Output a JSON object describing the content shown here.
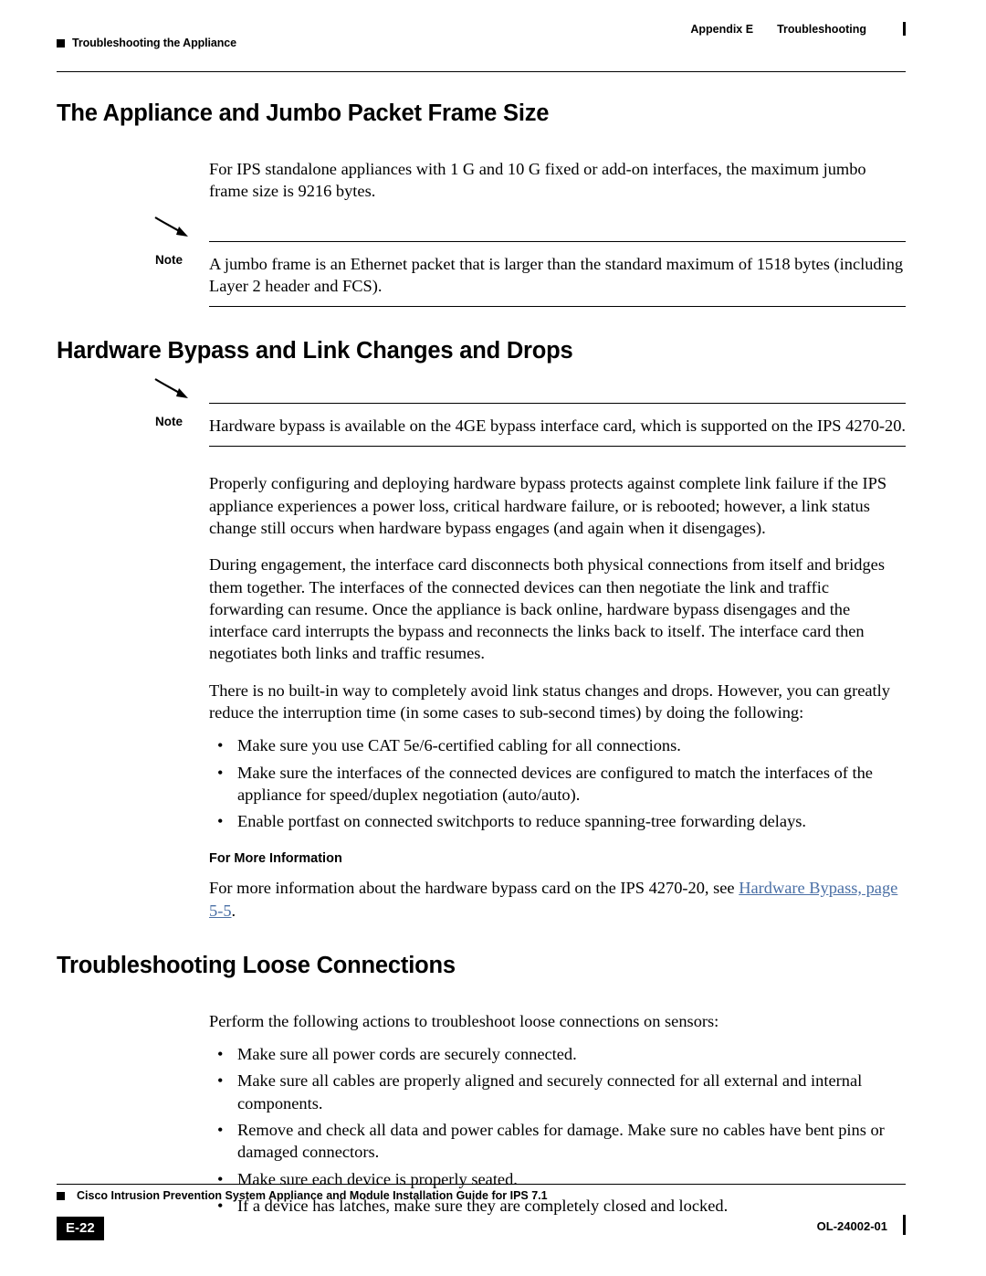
{
  "header": {
    "left_text": "Troubleshooting the Appliance",
    "right_appendix": "Appendix E",
    "right_title": "Troubleshooting"
  },
  "sections": {
    "jumbo": {
      "heading": "The Appliance and Jumbo Packet Frame Size",
      "para1": "For IPS standalone appliances with 1 G and 10 G fixed or add-on interfaces, the maximum jumbo frame size is 9216 bytes.",
      "note_label": "Note",
      "note_text": "A jumbo frame is an Ethernet packet that is larger than the standard maximum of 1518 bytes (including Layer 2 header and FCS)."
    },
    "hwbypass": {
      "heading": "Hardware Bypass and Link Changes and Drops",
      "note_label": "Note",
      "note_text": "Hardware bypass is available on the 4GE bypass interface card, which is supported on the IPS 4270-20.",
      "para1": "Properly configuring and deploying hardware bypass protects against complete link failure if the IPS appliance experiences a power loss, critical hardware failure, or is rebooted; however, a link status change still occurs when hardware bypass engages (and again when it disengages).",
      "para2": "During engagement, the interface card disconnects both physical connections from itself and bridges them together. The interfaces of the connected devices can then negotiate the link and traffic forwarding can resume. Once the appliance is back online, hardware bypass disengages and the interface card interrupts the bypass and reconnects the links back to itself. The interface card then negotiates both links and traffic resumes.",
      "para3": "There is no built-in way to completely avoid link status changes and drops. However, you can greatly reduce the interruption time (in some cases to sub-second times) by doing the following:",
      "bullets": [
        "Make sure you use CAT 5e/6-certified cabling for all connections.",
        "Make sure the interfaces of the connected devices are configured to match the interfaces of the appliance for speed/duplex negotiation (auto/auto).",
        "Enable portfast on connected switchports to reduce spanning-tree forwarding delays."
      ],
      "subhead": "For More Information",
      "more_info_prefix": "For more information about the hardware bypass card on the IPS 4270-20, see ",
      "more_info_link": "Hardware Bypass, page 5-5",
      "more_info_suffix": "."
    },
    "loose": {
      "heading": "Troubleshooting Loose Connections",
      "para1": "Perform the following actions to troubleshoot loose connections on sensors:",
      "bullets": [
        "Make sure all power cords are securely connected.",
        "Make sure all cables are properly aligned and securely connected for all external and internal components.",
        "Remove and check all data and power cables for damage. Make sure no cables have bent pins or damaged connectors.",
        "Make sure each device is properly seated.",
        "If a device has latches, make sure they are completely closed and locked."
      ]
    }
  },
  "footer": {
    "title": "Cisco Intrusion Prevention System Appliance and Module Installation Guide for IPS 7.1",
    "page": "E-22",
    "doc_id": "OL-24002-01"
  },
  "icons": {
    "note": "note-pencil-icon",
    "bullet": "•"
  }
}
